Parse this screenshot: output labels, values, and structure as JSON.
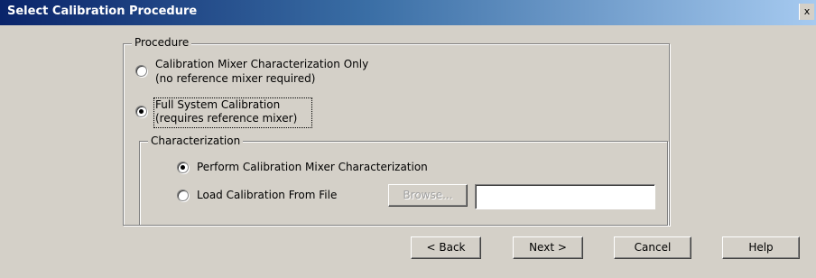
{
  "window": {
    "title": "Select Calibration Procedure",
    "close_glyph": "x"
  },
  "procedure": {
    "group_label": "Procedure",
    "options": [
      {
        "line1": "Calibration Mixer Characterization Only",
        "line2": "(no reference mixer required)",
        "selected": false
      },
      {
        "line1": "Full System Calibration",
        "line2": "(requires reference mixer)",
        "selected": true
      }
    ]
  },
  "characterization": {
    "group_label": "Characterization",
    "options": [
      {
        "label": "Perform Calibration Mixer Characterization",
        "selected": true
      },
      {
        "label": "Load Calibration From File",
        "selected": false
      }
    ],
    "browse_label": "Browse...",
    "file_path_value": ""
  },
  "buttons": {
    "back": "< Back",
    "next": "Next >",
    "cancel": "Cancel",
    "help": "Help"
  }
}
